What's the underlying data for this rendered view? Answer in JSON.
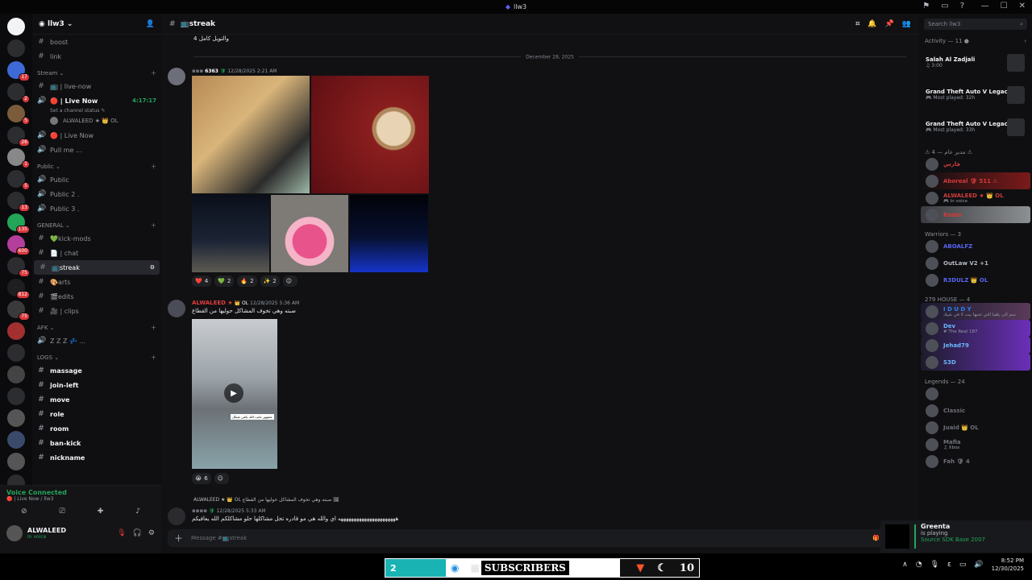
{
  "titlebar": {
    "title": "llw3"
  },
  "server": {
    "name": "llw3"
  },
  "servers": {
    "badges": [
      "55",
      "3",
      "17",
      "2",
      "5",
      "26",
      "1",
      "5",
      "13",
      "135",
      "600",
      "75",
      "812",
      "75"
    ]
  },
  "channels": {
    "items": [
      {
        "type": "text",
        "label": "boost"
      },
      {
        "type": "text",
        "label": "link"
      },
      {
        "type": "category",
        "label": "Stream ⌄"
      },
      {
        "type": "text",
        "label": "📺 | live-now"
      },
      {
        "type": "voice",
        "label": "🔴 | Live Now",
        "bold": true,
        "time": "4:17:17"
      },
      {
        "type": "status",
        "label": "Set a channel status ✎"
      },
      {
        "type": "user",
        "label": "ALWALEED ★ 👑 OL"
      },
      {
        "type": "voice",
        "label": "🔴 | Live Now"
      },
      {
        "type": "voice",
        "label": "Pull me ..."
      },
      {
        "type": "category",
        "label": "Public ⌄"
      },
      {
        "type": "voice",
        "label": "Public"
      },
      {
        "type": "voice",
        "label": "Public 2 ."
      },
      {
        "type": "voice",
        "label": "Public 3 ."
      },
      {
        "type": "category",
        "label": "GENERAL ⌄"
      },
      {
        "type": "text",
        "label": "💚kick-mods"
      },
      {
        "type": "text",
        "label": "📄 | chat"
      },
      {
        "type": "text",
        "label": "📺streak",
        "active": true
      },
      {
        "type": "text",
        "label": "🎨arts"
      },
      {
        "type": "text",
        "label": "🎬edits"
      },
      {
        "type": "text",
        "label": "🎥 | clips"
      },
      {
        "type": "category",
        "label": "AFK ⌄"
      },
      {
        "type": "voice",
        "label": "Z Z Z 💤 ..."
      },
      {
        "type": "category",
        "label": "LOGS ⌄"
      },
      {
        "type": "text",
        "label": "massage",
        "bold": true
      },
      {
        "type": "text",
        "label": "join-left",
        "bold": true
      },
      {
        "type": "text",
        "label": "move",
        "bold": true
      },
      {
        "type": "text",
        "label": "role",
        "bold": true
      },
      {
        "type": "text",
        "label": "room",
        "bold": true
      },
      {
        "type": "text",
        "label": "ban-kick",
        "bold": true
      },
      {
        "type": "text",
        "label": "nickname",
        "bold": true
      }
    ]
  },
  "voice": {
    "connected": "Voice Connected",
    "sub": "🔴 | Live Now / llw3"
  },
  "user": {
    "name": "ALWALEED",
    "status": "In voice"
  },
  "chat": {
    "channel": "📺streak",
    "top_text": "والتويل كامل 4",
    "date_divider": "December 28, 2025",
    "msg1": {
      "badge": "6363",
      "time": "12/28/2025 2:21 AM"
    },
    "reactions1": [
      {
        "e": "❤️",
        "n": "4"
      },
      {
        "e": "💚",
        "n": "2"
      },
      {
        "e": "🔥",
        "n": "2"
      },
      {
        "e": "✨",
        "n": "2"
      },
      {
        "e": "☺",
        "n": ""
      }
    ],
    "msg2": {
      "name": "ALWALEED ★",
      "tag": "👑 OL",
      "time": "12/28/2025 5:36 AM",
      "text": "صبته وهي تخوف المشاكل حوليها من القطاع"
    },
    "video_caption": "مشهور عايب الله يكفي شيكل",
    "reactions2": [
      {
        "e": "😭",
        "n": "6"
      },
      {
        "e": "☺",
        "n": ""
      }
    ],
    "reply": "ALWALEED ★ 👑 OL  صبته وهي تخوف المشاكل حوليها من القطاع 🖼",
    "msg3": {
      "time": "12/28/2025 5:33 AM",
      "text": "ههههههههههههههههههههههه اي والله هي مو قادره تحل مشاكلها حلو مشاكلكم الله يعافيكم"
    },
    "input_placeholder": "Message #📺streak"
  },
  "members": {
    "search_placeholder": "Search llw3",
    "activity_title": "Activity — 11 ●",
    "activities": [
      {
        "name": "Salah Al Zadjali",
        "sub": "♫ 3:00"
      },
      {
        "name": "Grand Theft Auto V Legacy",
        "sub": "🎮 Most played: 32h"
      },
      {
        "name": "Grand Theft Auto V Legacy",
        "sub": "🎮 Most played: 33h"
      }
    ],
    "groups": [
      {
        "title": "⚠ 4 — مدير عام ⚠",
        "members": [
          {
            "name": "فارس",
            "color": "#d23b3b"
          },
          {
            "name": "Aboreal 🛡 511 ⚠",
            "color": "#d23b3b"
          },
          {
            "name": "ALWALEED ★  👑 OL",
            "color": "#d23b3b",
            "sub": "🎮 In voice"
          },
          {
            "name": "Rader",
            "color": "#d23b3b"
          }
        ]
      },
      {
        "title": "Warriors — 3",
        "members": [
          {
            "name": "ABOALFZ",
            "color": "#5865f2"
          },
          {
            "name": "OutLaw V2 +1",
            "color": "#b5bac1"
          },
          {
            "name": "R3DULZ 👑 OL",
            "color": "#5865f2"
          }
        ]
      },
      {
        "title": "279 HOUSE — 4",
        "members": [
          {
            "name": "I D U D Y",
            "color": "#2f80ed",
            "sub": "سم الى يلقيا التي تحبها بيت لا في شيك"
          },
          {
            "name": "Dev",
            "color": "#6ab7ff",
            "sub": "# The Real 187"
          },
          {
            "name": "Jehad79",
            "color": "#6ab7ff"
          },
          {
            "name": "S3D",
            "color": "#6ab7ff"
          }
        ]
      },
      {
        "title": "Legends — 24",
        "members": [
          {
            "name": "",
            "color": "#b5bac1"
          },
          {
            "name": "Classic",
            "color": "#6d6f78"
          },
          {
            "name": "Juaid 👑 OL",
            "color": "#6d6f78"
          },
          {
            "name": "Mafia",
            "color": "#6d6f78",
            "sub": "♫ Xbox"
          },
          {
            "name": "Fah 🛡 4",
            "color": "#6d6f78"
          }
        ]
      }
    ]
  },
  "notification": {
    "name": "Greenta",
    "status": "is playing",
    "game": "Source SDK Base 2007"
  },
  "taskbar": {
    "left_num": "2",
    "subscribers": "SUBSCRIBERS",
    "right_num": "10",
    "time": "8:52 PM",
    "date": "12/30/2025"
  },
  "colors": {
    "accent": "#5865f2",
    "green": "#23a55a",
    "red": "#da373c"
  }
}
